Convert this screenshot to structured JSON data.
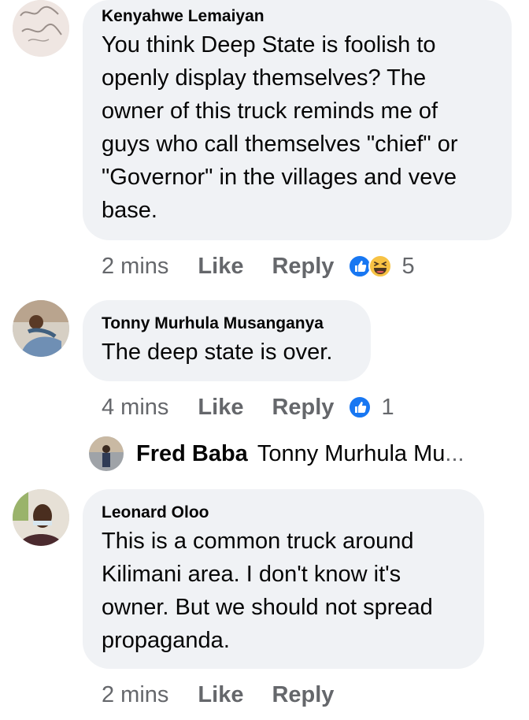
{
  "comments": [
    {
      "author": "Kenyahwe Lemaiyan",
      "text": "You think Deep State is foolish to\nopenly display themselves? The\nowner of this truck reminds me of\nguys who call themselves \"chief\" or\n\"Governor\" in the villages and veve\nbase.",
      "time": "2 mins",
      "like": "Like",
      "reply": "Reply",
      "reactions": [
        "like-reaction-icon",
        "haha-reaction-icon"
      ],
      "reaction_count": "5"
    },
    {
      "author": "Tonny Murhula Musanganya",
      "text": "The deep state is over.",
      "time": "4 mins",
      "like": "Like",
      "reply": "Reply",
      "reactions": [
        "like-reaction-icon"
      ],
      "reaction_count": "1"
    },
    {
      "author": "Leonard Oloo",
      "text": "This is a common truck around\nKilimani area. I don't know it's\nowner. But we should not spread\npropaganda.",
      "time": "2 mins",
      "like": "Like",
      "reply": "Reply"
    }
  ],
  "reply_preview": {
    "author": "Fred Baba",
    "text": "Tonny Murhula Mu",
    "ellipsis": "..."
  },
  "colors": {
    "bubble": "#f0f2f5",
    "secondary_text": "#65676b",
    "like_blue": "#1877f2",
    "haha_yellow": "#f7c244"
  }
}
